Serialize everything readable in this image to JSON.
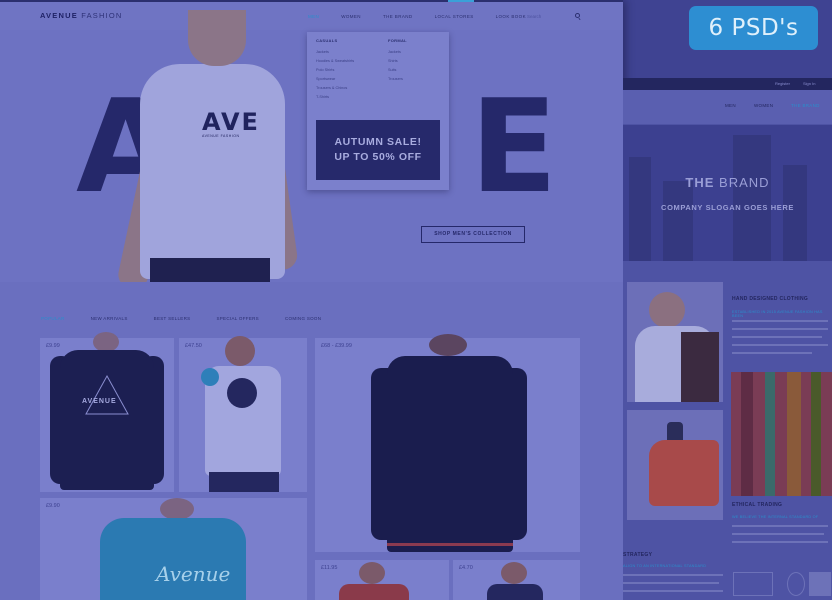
{
  "main_page": {
    "logo_bold": "AVENUE",
    "logo_light": "FASHION",
    "nav": [
      {
        "label": "MEN",
        "active": true
      },
      {
        "label": "WOMEN",
        "active": false
      },
      {
        "label": "THE BRAND",
        "active": false
      },
      {
        "label": "LOCAL STORES",
        "active": false
      },
      {
        "label": "LOOK BOOK",
        "active": false
      }
    ],
    "search_placeholder": "Search",
    "hero_letters": [
      "A",
      "V",
      "E"
    ],
    "tee_print": "AVE",
    "tee_print_sub": "AVENUE FASHION",
    "dropdown": {
      "col1_head": "Casuals",
      "col1_items": [
        "Jackets",
        "Hoodies & Sweatshirts",
        "Polo Shirts",
        "Sportswear",
        "Trousers & Chinos",
        "T-Shirts"
      ],
      "col2_head": "Formal",
      "col2_items": [
        "Jackets",
        "Shirts",
        "Suits",
        "Trousers"
      ]
    },
    "sale_line1": "AUTUMN SALE!",
    "sale_line2": "UP TO 50% OFF",
    "shop_button": "SHOP MEN'S COLLECTION",
    "tabs": [
      {
        "label": "Popular",
        "active": true
      },
      {
        "label": "New Arrivals",
        "active": false
      },
      {
        "label": "Best Sellers",
        "active": false
      },
      {
        "label": "Special Offers",
        "active": false
      },
      {
        "label": "Coming Soon",
        "active": false
      }
    ],
    "products": [
      {
        "price": "£9.99",
        "print": "AVENUE"
      },
      {
        "price": "£47.50"
      },
      {
        "price": "£68 - £39.99"
      },
      {
        "price": "£9.90",
        "print": "Avenue"
      },
      {
        "price": "£11.95"
      },
      {
        "price": "£4.70"
      }
    ]
  },
  "side_page": {
    "top_links": [
      "Register",
      "Sign In"
    ],
    "nav": [
      {
        "label": "MEN",
        "active": false
      },
      {
        "label": "WOMEN",
        "active": false
      },
      {
        "label": "THE BRAND",
        "active": true
      }
    ],
    "brand_bold": "THE",
    "brand_light": "BRAND",
    "slogan": "COMPANY SLOGAN GOES HERE",
    "section1_title": "HAND DESIGNED CLOTHING",
    "section1_sub": "ESTABLISHED IN 2015 AVENUE FASHION HAS BEEN",
    "section2_title": "ETHICAL TRADING",
    "section2_sub": "WE BELIEVE THE INTERNAL STANDARD OF",
    "section3_title": "STRATEGY",
    "section3_sub": "ALIGN TO AN INTERNATIONAL STANDARD"
  },
  "badge": "6 PSD's"
}
